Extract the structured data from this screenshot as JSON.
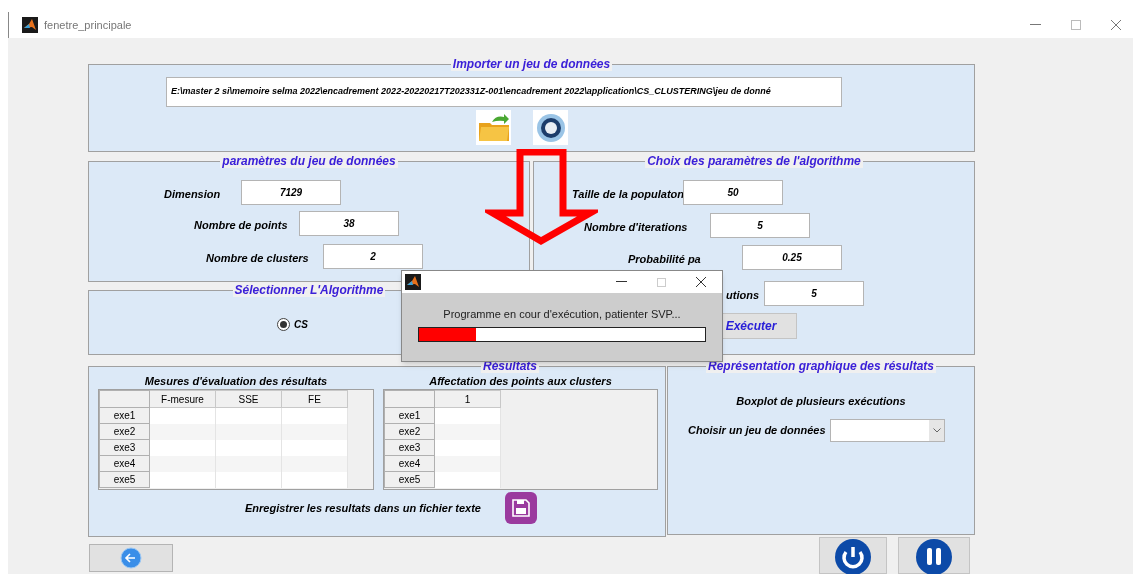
{
  "window": {
    "title": "fenetre_principale"
  },
  "import_panel": {
    "title": "Importer un jeu de données",
    "path": "E:\\master 2 si\\memoire selma 2022\\encadrement 2022-20220217T202331Z-001\\encadrement 2022\\application\\CS_CLUSTERING\\jeu de donné"
  },
  "dataset_panel": {
    "title": "paramètres du jeu de données",
    "fields": [
      {
        "label": "Dimension",
        "value": "7129"
      },
      {
        "label": "Nombre de points",
        "value": "38"
      },
      {
        "label": "Nombre de clusters",
        "value": "2"
      }
    ]
  },
  "algorithm_panel": {
    "title": "Sélectionner  L'Algorithme",
    "options": [
      {
        "label": "CS",
        "selected": true
      }
    ]
  },
  "parameters_panel": {
    "title": "Choix des paramètres de l'algorithme",
    "fields": [
      {
        "label": "Taille de la populaton",
        "value": "50"
      },
      {
        "label": "Nombre d'iterations",
        "value": "5"
      },
      {
        "label": "Probabilité pa",
        "value": "0.25"
      },
      {
        "label": "utions",
        "value": "5"
      }
    ],
    "button": "Exécuter"
  },
  "results_panel": {
    "title": "Résultats",
    "tables": [
      {
        "title": "Mesures d'évaluation des résultats",
        "columns": [
          "F-mesure",
          "SSE",
          "FE"
        ],
        "rows": [
          "exe1",
          "exe2",
          "exe3",
          "exe4",
          "exe5"
        ]
      },
      {
        "title": "Affectation des points aux clusters",
        "columns": [
          "1"
        ],
        "rows": [
          "exe1",
          "exe2",
          "exe3",
          "exe4",
          "exe5"
        ]
      }
    ],
    "save_label": "Enregistrer les resultats dans un fichier texte"
  },
  "chart_panel": {
    "title": "Représentation graphique des résultats",
    "subtitle": "Boxplot de plusieurs exécutions",
    "select_label": "Choisir un jeu de données"
  },
  "progress_dialog": {
    "message": "Programme en cour d'exécution, patienter SVP...",
    "level": 0.2
  }
}
